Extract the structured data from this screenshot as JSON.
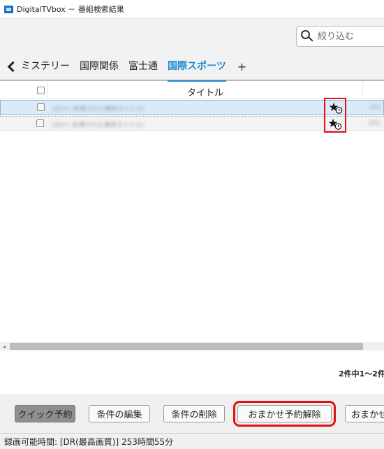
{
  "window": {
    "title": "DigitalTVbox － 番組検索結果"
  },
  "search": {
    "placeholder": "絞り込む"
  },
  "tabs": [
    {
      "label": "ミステリー"
    },
    {
      "label": "国際関係"
    },
    {
      "label": "富士通"
    },
    {
      "label": "国際スポーツ"
    }
  ],
  "tab_add_label": "+",
  "table": {
    "columns": {
      "title": "タイトル"
    },
    "rows": [
      {
        "title": "（ぼかし処理された番組タイトル）",
        "status_icon": "auto-reservation-star-icon",
        "extra": "201"
      },
      {
        "title": "（ぼかし処理された番組タイトル）",
        "status_icon": "auto-reservation-star-icon",
        "extra": "201"
      }
    ]
  },
  "result_count": "2件中1～2件",
  "buttons": {
    "quick": "クイック予約",
    "edit": "条件の編集",
    "delete": "条件の削除",
    "cancel_auto": "おまかせ予約解除",
    "auto": "おまかせ"
  },
  "status": {
    "recording_time": "録画可能時間: [DR(最高画質)] 253時間55分"
  },
  "colors": {
    "accent": "#1a8ad4",
    "highlight": "#e21010",
    "selected_row": "#dce9f7"
  }
}
